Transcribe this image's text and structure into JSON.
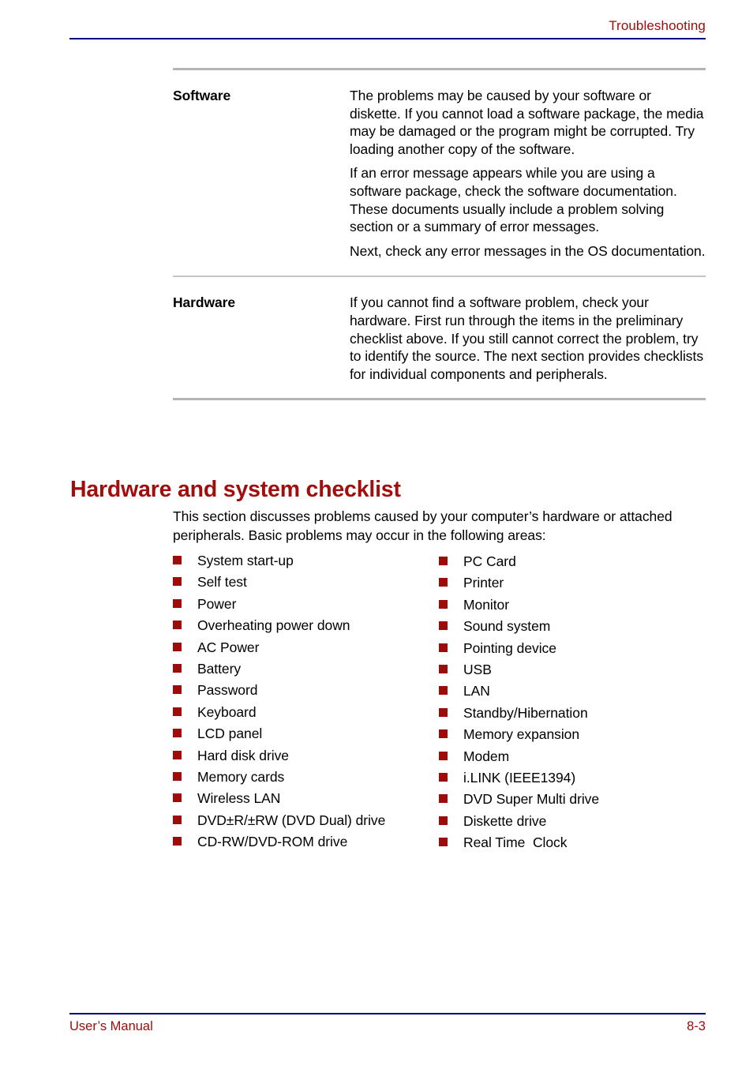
{
  "header": {
    "title": "Troubleshooting",
    "rule_color": "#00007f",
    "text_color": "#9e0b0b"
  },
  "definition_table": {
    "rows": [
      {
        "term": "Software",
        "paragraphs": [
          "The problems may be caused by your software or diskette. If you cannot load a software package, the media may be damaged or the program might be corrupted. Try loading another copy of the software.",
          "If an error message appears while you are using a software package, check the software documentation. These documents usually include a problem solving section or a summary of error messages.",
          "Next, check any error messages in the OS documentation."
        ]
      },
      {
        "term": "Hardware",
        "paragraphs": [
          "If you cannot find a software problem, check your hardware. First run through the items in the preliminary checklist above. If you still cannot correct the problem, try to identify the source. The next section provides checklists for individual components and peripherals."
        ]
      }
    ]
  },
  "section": {
    "heading": "Hardware and system checklist",
    "heading_color": "#a30d0d",
    "intro": "This section discusses problems caused by your computer’s hardware or attached peripherals. Basic problems may occur in the following areas:"
  },
  "checklist": {
    "bullet_color": "#9e0b0b",
    "left_column": [
      "System start-up",
      "Self test",
      "Power",
      "Overheating power down",
      "AC Power",
      "Battery",
      "Password",
      "Keyboard",
      "LCD panel",
      "Hard disk drive",
      "Memory cards",
      "Wireless LAN",
      "DVD±R/±RW (DVD Dual) drive",
      "CD-RW/DVD-ROM drive"
    ],
    "right_column": [
      "PC Card",
      "Printer",
      "Monitor",
      "Sound system",
      "Pointing device",
      "USB",
      "LAN",
      "Standby/Hibernation",
      "Memory expansion",
      "Modem",
      "i.LINK (IEEE1394)",
      "DVD Super Multi drive",
      "Diskette drive",
      "Real Time  Clock"
    ]
  },
  "footer": {
    "manual_label": "User’s Manual",
    "page_number": "8-3",
    "rule_color": "#00007f",
    "text_color": "#9e0b0b"
  }
}
